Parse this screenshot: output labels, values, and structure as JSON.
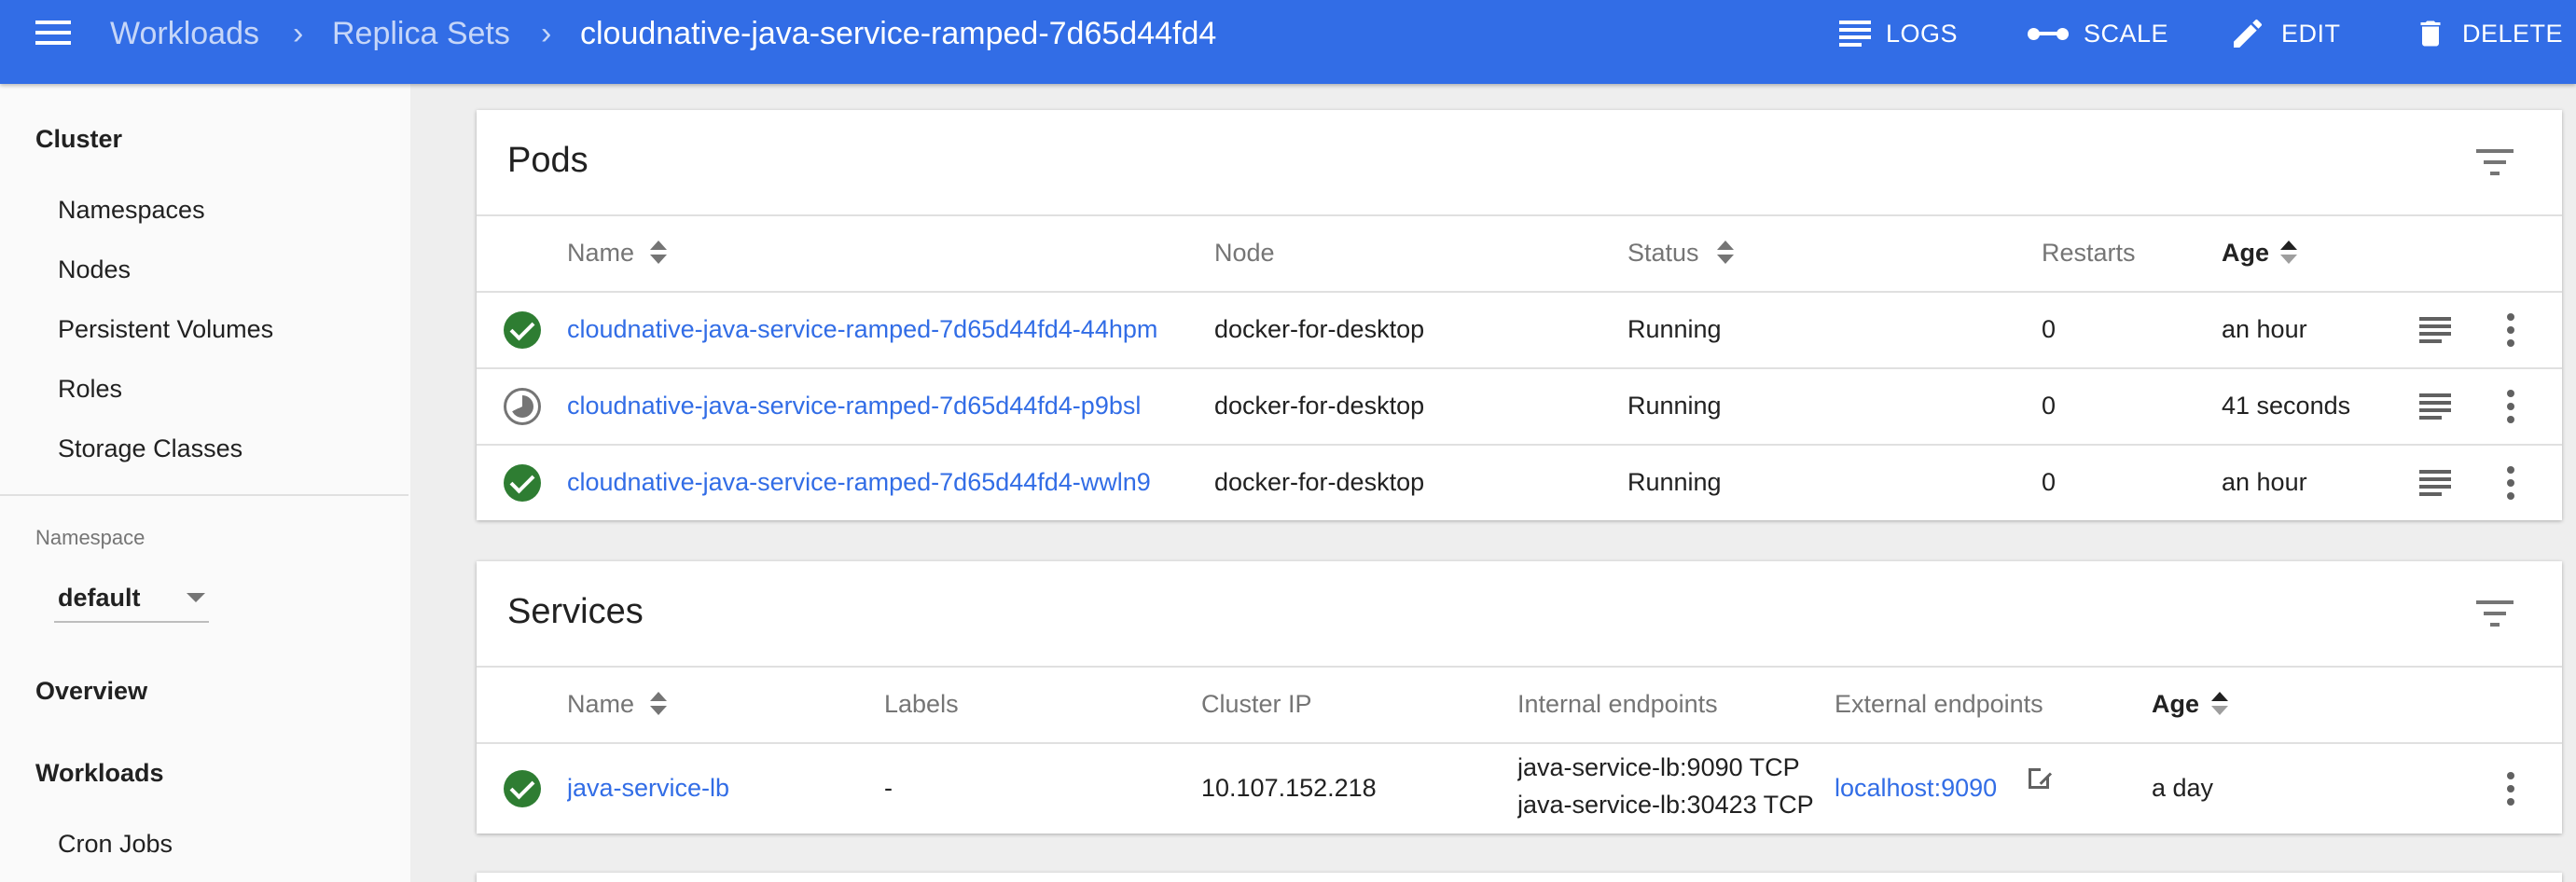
{
  "header": {
    "breadcrumb": [
      "Workloads",
      "Replica Sets"
    ],
    "title": "cloudnative-java-service-ramped-7d65d44fd4",
    "actions": {
      "logs": "LOGS",
      "scale": "SCALE",
      "edit": "EDIT",
      "delete": "DELETE"
    }
  },
  "sidebar": {
    "cluster": {
      "title": "Cluster",
      "items": [
        "Namespaces",
        "Nodes",
        "Persistent Volumes",
        "Roles",
        "Storage Classes"
      ]
    },
    "namespace": {
      "label": "Namespace",
      "value": "default"
    },
    "overview": "Overview",
    "workloads": {
      "title": "Workloads",
      "items": [
        "Cron Jobs"
      ]
    }
  },
  "pods": {
    "title": "Pods",
    "headers": {
      "name": "Name",
      "node": "Node",
      "status": "Status",
      "restarts": "Restarts",
      "age": "Age"
    },
    "rows": [
      {
        "name": "cloudnative-java-service-ramped-7d65d44fd4-44hpm",
        "node": "docker-for-desktop",
        "status": "Running",
        "restarts": "0",
        "age": "an hour",
        "state": "ok"
      },
      {
        "name": "cloudnative-java-service-ramped-7d65d44fd4-p9bsl",
        "node": "docker-for-desktop",
        "status": "Running",
        "restarts": "0",
        "age": "41 seconds",
        "state": "pending"
      },
      {
        "name": "cloudnative-java-service-ramped-7d65d44fd4-wwln9",
        "node": "docker-for-desktop",
        "status": "Running",
        "restarts": "0",
        "age": "an hour",
        "state": "ok"
      }
    ]
  },
  "services": {
    "title": "Services",
    "headers": {
      "name": "Name",
      "labels": "Labels",
      "cluster_ip": "Cluster IP",
      "internal": "Internal endpoints",
      "external": "External endpoints",
      "age": "Age"
    },
    "rows": [
      {
        "name": "java-service-lb",
        "labels": "-",
        "cluster_ip": "10.107.152.218",
        "internal": [
          "java-service-lb:9090 TCP",
          "java-service-lb:30423 TCP"
        ],
        "external": "localhost:9090",
        "age": "a day"
      }
    ]
  },
  "colors": {
    "primary": "#326de6",
    "success": "#2e7d32",
    "background": "#eeeeee"
  },
  "icons": [
    "menu-icon",
    "logs-icon",
    "scale-icon",
    "edit-icon",
    "delete-icon",
    "filter-icon",
    "check-circle-icon",
    "pending-icon",
    "more-vert-icon",
    "open-in-new-icon"
  ]
}
